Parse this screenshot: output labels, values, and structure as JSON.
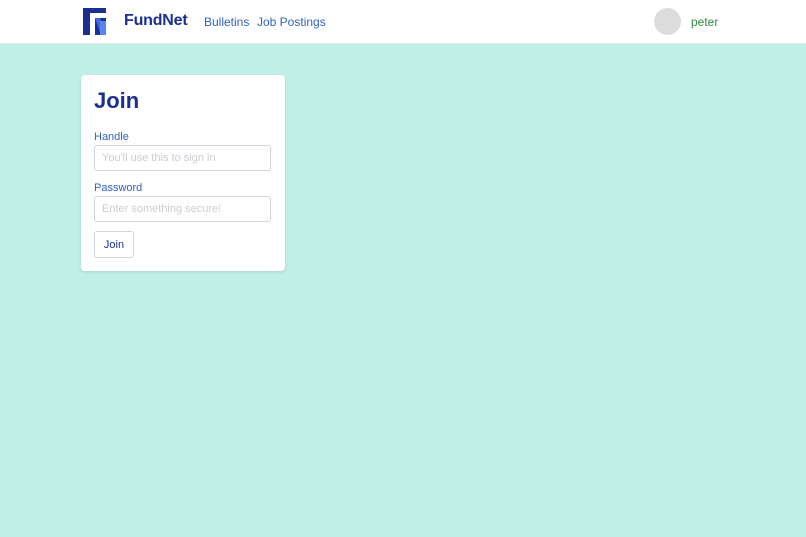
{
  "header": {
    "brand": "FundNet",
    "logo_icon": "fundnet-logo-icon",
    "nav": [
      {
        "label": "Bulletins"
      },
      {
        "label": "Job Postings"
      }
    ],
    "user": {
      "name": "peter",
      "avatar_icon": "avatar"
    }
  },
  "join_form": {
    "title": "Join",
    "handle": {
      "label": "Handle",
      "placeholder": "You'll use this to sign in",
      "value": ""
    },
    "password": {
      "label": "Password",
      "placeholder": "Enter something secure!",
      "value": ""
    },
    "submit_label": "Join"
  },
  "colors": {
    "page_background": "#c0efe7",
    "brand": "#1a2f8f",
    "link": "#2f63c4",
    "username": "#2e8b3b"
  }
}
